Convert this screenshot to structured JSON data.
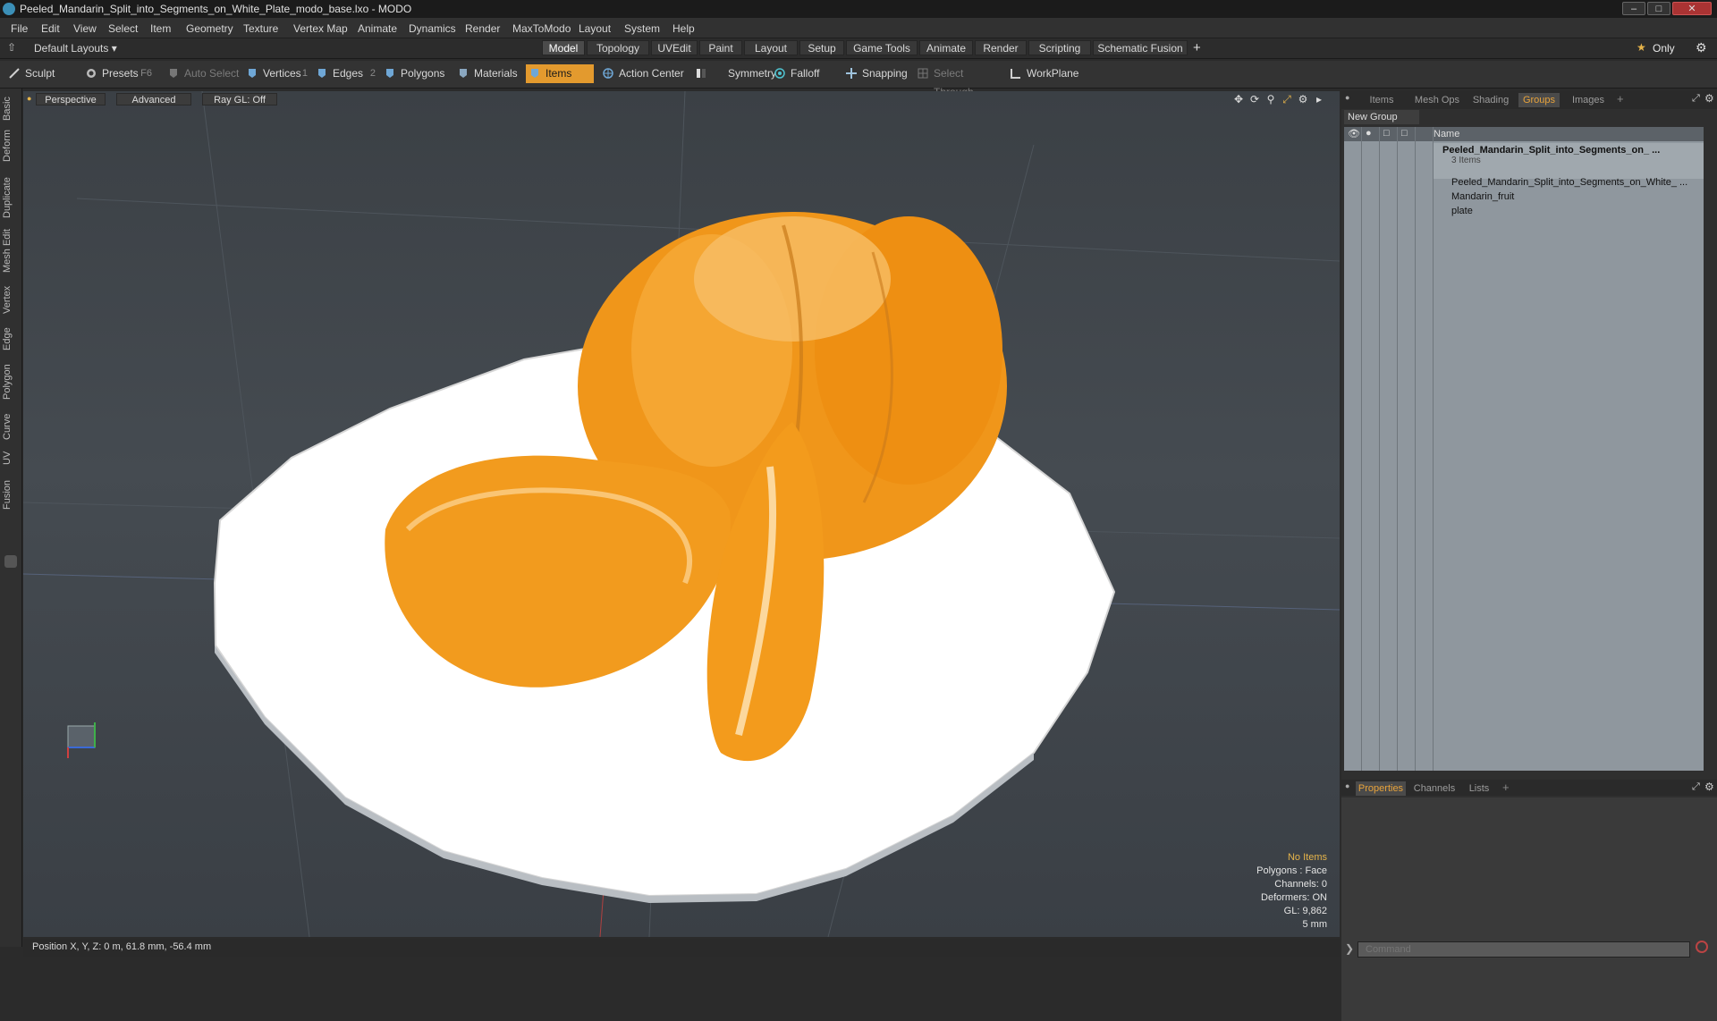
{
  "window": {
    "title": "Peeled_Mandarin_Split_into_Segments_on_White_Plate_modo_base.lxo - MODO"
  },
  "menu": [
    "File",
    "Edit",
    "View",
    "Select",
    "Item",
    "Geometry",
    "Texture",
    "Vertex Map",
    "Animate",
    "Dynamics",
    "Render",
    "MaxToModo",
    "Layout",
    "System",
    "Help"
  ],
  "layouts": {
    "default": "Default Layouts",
    "tabs": [
      "Model",
      "Topology",
      "UVEdit",
      "Paint",
      "Layout",
      "Setup",
      "Game Tools",
      "Animate",
      "Render",
      "Scripting",
      "Schematic Fusion"
    ],
    "active": "Model",
    "only": "Only"
  },
  "toolbar": {
    "sculpt": "Sculpt",
    "presets": "Presets",
    "presets_key": "F6",
    "auto_select": "Auto Select",
    "vertices": "Vertices",
    "vertices_key": "1",
    "edges": "Edges",
    "edges_key": "2",
    "polygons": "Polygons",
    "materials": "Materials",
    "items": "Items",
    "action_center": "Action Center",
    "symmetry": "Symmetry",
    "falloff": "Falloff",
    "snapping": "Snapping",
    "select_through": "Select Through",
    "workplane": "WorkPlane"
  },
  "left_tabs": [
    "Basic",
    "Deform",
    "Duplicate",
    "Mesh Edit",
    "Vertex",
    "Edge",
    "Polygon",
    "Curve",
    "UV",
    "Fusion"
  ],
  "viewport": {
    "perspective": "Perspective",
    "advanced": "Advanced",
    "raygl": "Ray GL: Off",
    "hud": {
      "no_items": "No Items",
      "polygons": "Polygons : Face",
      "channels": "Channels: 0",
      "deformers": "Deformers: ON",
      "gl": "GL: 9,862",
      "unit": "5 mm"
    }
  },
  "status": {
    "position": "Position X, Y, Z:  0 m, 61.8 mm, -56.4 mm"
  },
  "right_panel": {
    "tabs": [
      "Items",
      "Mesh Ops",
      "Shading",
      "Groups",
      "Images"
    ],
    "active_tab": "Groups",
    "new_group": "New Group",
    "name_col": "Name",
    "group_name": "Peeled_Mandarin_Split_into_Segments_on_ ...",
    "group_count": "3 Items",
    "items": [
      "Peeled_Mandarin_Split_into_Segments_on_White_ ...",
      "Mandarin_fruit",
      "plate"
    ]
  },
  "bottom_panel": {
    "tabs": [
      "Properties",
      "Channels",
      "Lists"
    ],
    "active_tab": "Properties",
    "command_placeholder": "Command"
  },
  "colors": {
    "accent": "#e39a2e",
    "mandarin": "#f09a1c",
    "plate": "#ffffff"
  }
}
